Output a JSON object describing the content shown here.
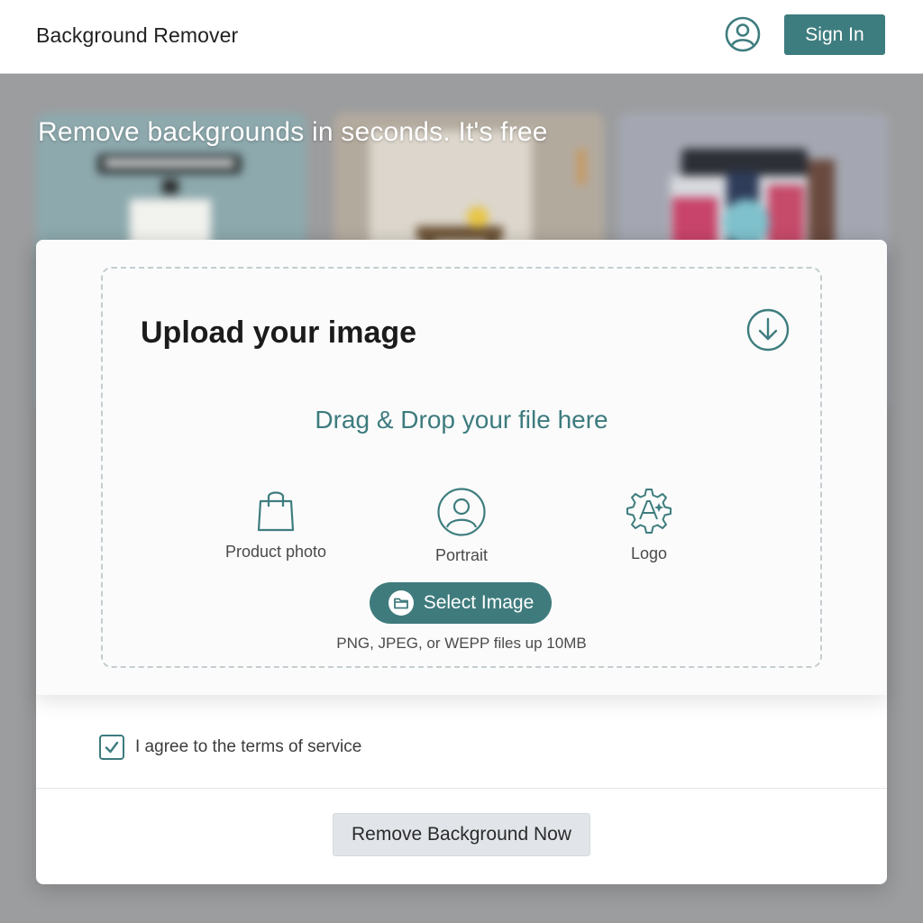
{
  "header": {
    "title": "Background Remover",
    "account_icon": "user-circle-icon",
    "signin_label": "Sign In"
  },
  "hero": {
    "text": "Remove backgrounds in seconds. It's free"
  },
  "upload": {
    "title": "Upload your image",
    "download_icon": "arrow-down-circle-icon",
    "drag_text": "Drag & Drop your file here",
    "types": [
      {
        "label": "Product photo",
        "icon": "shopping-bag-icon"
      },
      {
        "label": "Portrait",
        "icon": "user-circle-icon"
      },
      {
        "label": "Logo",
        "icon": "gear-letter-a-icon"
      }
    ],
    "select_label": "Select Image",
    "select_icon": "folder-icon",
    "file_hint": "PNG, JPEG, or WEPP files up 10MB"
  },
  "terms": {
    "checked": true,
    "label": "I agree to the terms of service"
  },
  "actions": {
    "remove_label": "Remove Background Now"
  },
  "colors": {
    "accent": "#3e7d7f",
    "page_background": "#9c9d9f",
    "card": "#ffffff",
    "secondary_button": "#e1e5e9"
  }
}
